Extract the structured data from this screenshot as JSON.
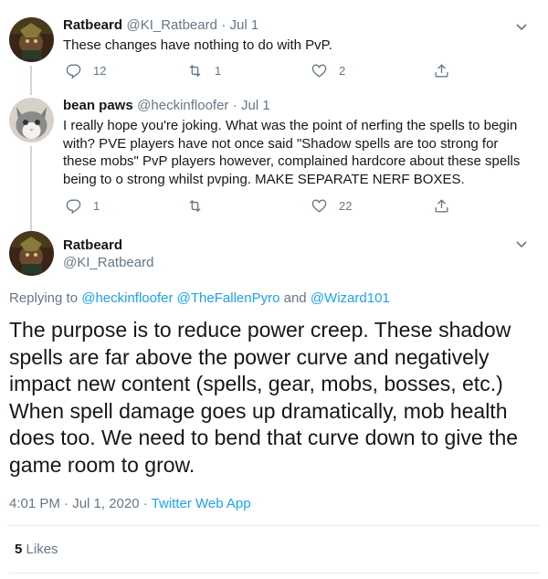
{
  "tweets": [
    {
      "name": "Ratbeard",
      "handle": "@KI_Ratbeard",
      "time": "· Jul 1",
      "text": "These changes have nothing to do with PvP.",
      "replies": "12",
      "retweets": "1",
      "likes": "2"
    },
    {
      "name": "bean paws",
      "handle": "@heckinfloofer",
      "time": "· Jul 1",
      "text": "I really hope you're joking. What was the point of nerfing the spells to begin with? PVE players have not once said \"Shadow spells are too strong for these mobs\" PvP players however, complained hardcore about these spells being to o strong whilst pvping. MAKE SEPARATE NERF BOXES.",
      "replies": "1",
      "retweets": "",
      "likes": "22"
    }
  ],
  "main": {
    "name": "Ratbeard",
    "handle": "@KI_Ratbeard",
    "replying_prefix": "Replying to",
    "mention1": "@heckinfloofer",
    "mention2": "@TheFallenPyro",
    "and": "and",
    "mention3": "@Wizard101",
    "text": "The purpose is to reduce power creep. These shadow spells are far above the power curve and negatively impact new content (spells, gear, mobs, bosses, etc.) When spell damage goes up dramatically, mob health does too. We need to bend that curve down to give the game room to grow.",
    "time": "4:01 PM · Jul 1, 2020 ·",
    "source": "Twitter Web App",
    "likes_count": "5",
    "likes_label": "Likes"
  },
  "colors": {
    "accent": "#1da1f2",
    "secondary_text": "#657786",
    "thread_line": "#ccd6dd"
  },
  "icons": [
    "reply-icon",
    "retweet-icon",
    "like-icon",
    "share-icon",
    "chevron-down-icon"
  ]
}
